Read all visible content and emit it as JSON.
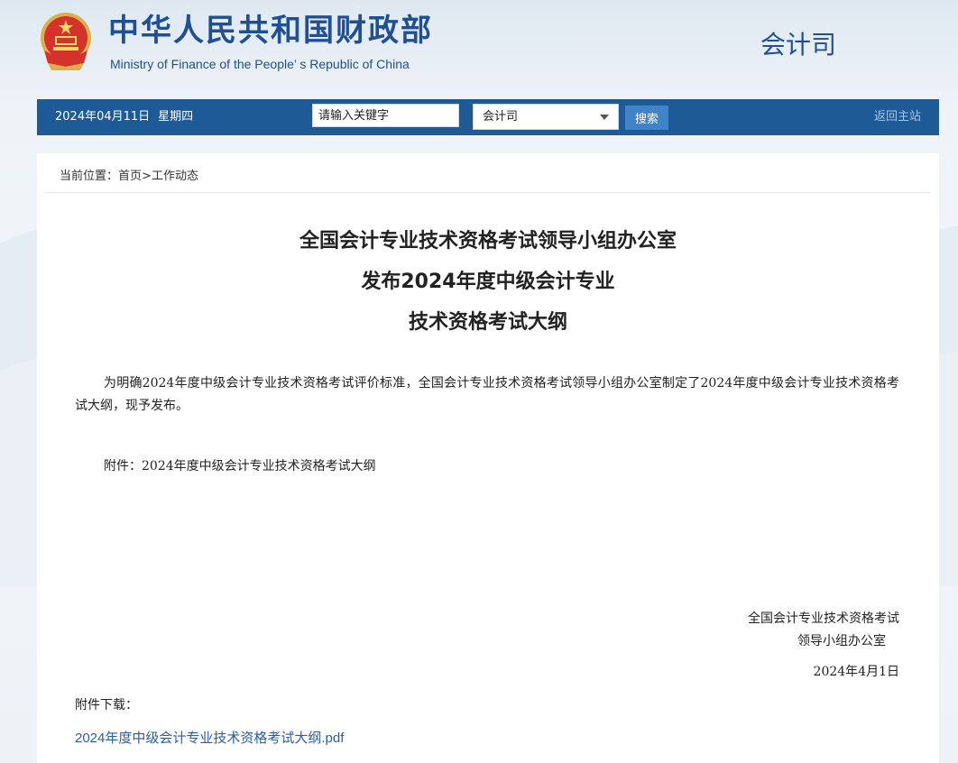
{
  "header": {
    "title_cn": "中华人民共和国财政部",
    "title_en": "Ministry of Finance of the People’ s Republic of China",
    "department": "会计司",
    "emblem_icon": "national-emblem-icon"
  },
  "navbar": {
    "date": "2024年04月11日",
    "weekday": "星期四",
    "search_placeholder": "请输入关键字",
    "search_value": "",
    "dept_select_value": "会计司",
    "search_button": "搜索",
    "home_link": "返回主站",
    "bar_color": "#1d5a96",
    "button_color": "#3f83c8"
  },
  "breadcrumb": {
    "prefix": "当前位置：",
    "home": "首页",
    "separator": ">",
    "current": "工作动态"
  },
  "article": {
    "title_lines": [
      "全国会计专业技术资格考试领导小组办公室",
      "发布2024年度中级会计专业",
      "技术资格考试大纲"
    ],
    "body": "为明确2024年度中级会计专业技术资格考试评价标准，全国会计专业技术资格考试领导小组办公室制定了2024年度中级会计专业技术资格考试大纲，现予发布。",
    "attachment_note": "附件：2024年度中级会计专业技术资格考试大纲",
    "signature_line1": "全国会计专业技术资格考试",
    "signature_line2": "领导小组办公室",
    "signature_date": "2024年4月1日"
  },
  "downloads": {
    "label": "附件下载：",
    "file_name": "2024年度中级会计专业技术资格考试大纲.pdf",
    "link_color": "#2a5ca8"
  }
}
